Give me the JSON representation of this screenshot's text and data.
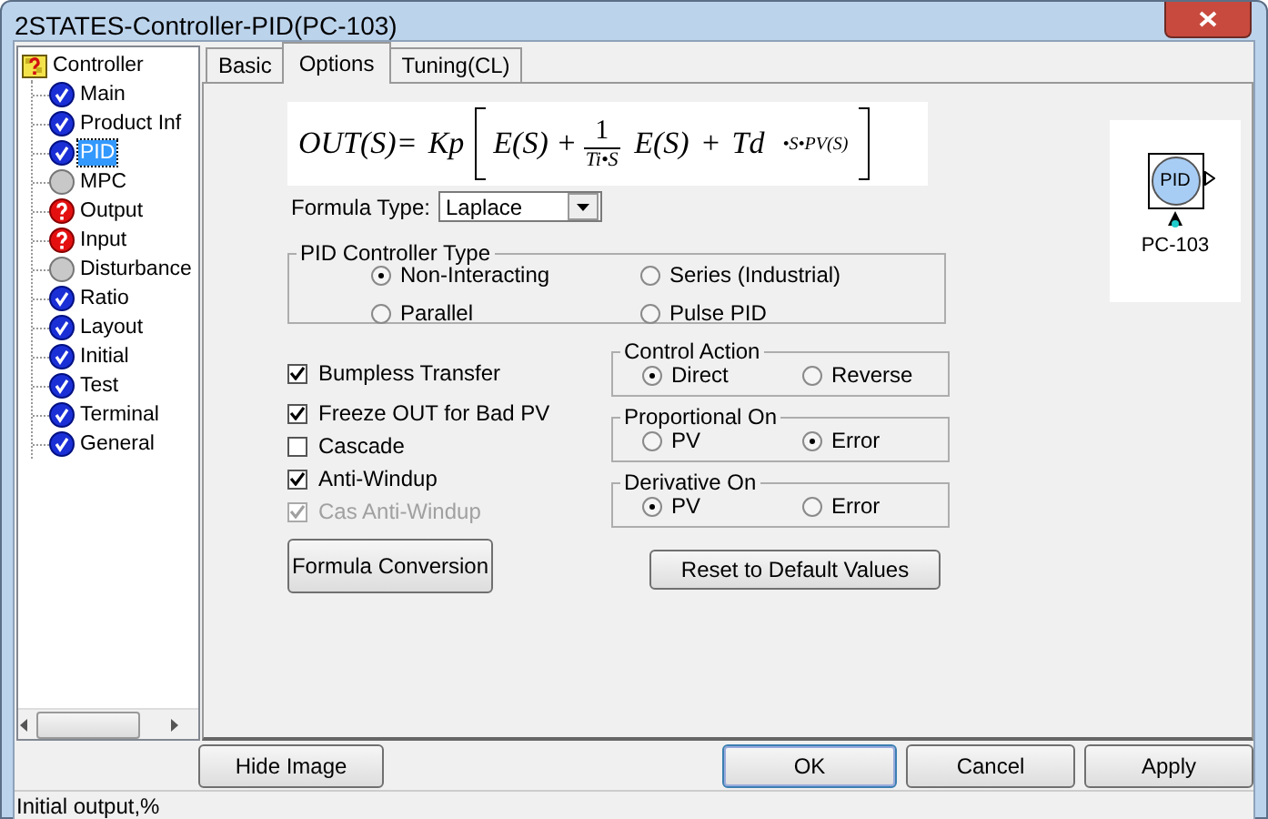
{
  "window": {
    "title": "2STATES-Controller-PID(PC-103)"
  },
  "tree": {
    "label": "Controller",
    "children": [
      {
        "label": "Main",
        "kind": "ok",
        "selected": false
      },
      {
        "label": "Product Inf",
        "kind": "ok",
        "selected": false
      },
      {
        "label": "PID",
        "kind": "ok",
        "selected": true
      },
      {
        "label": "MPC",
        "kind": "none",
        "selected": false
      },
      {
        "label": "Output",
        "kind": "error",
        "selected": false
      },
      {
        "label": "Input",
        "kind": "error",
        "selected": false
      },
      {
        "label": "Disturbance",
        "kind": "none",
        "selected": false
      },
      {
        "label": "Ratio",
        "kind": "ok",
        "selected": false
      },
      {
        "label": "Layout",
        "kind": "ok",
        "selected": false
      },
      {
        "label": "Initial",
        "kind": "ok",
        "selected": false
      },
      {
        "label": "Test",
        "kind": "ok",
        "selected": false
      },
      {
        "label": "Terminal",
        "kind": "ok",
        "selected": false
      },
      {
        "label": "General",
        "kind": "ok",
        "selected": false
      }
    ]
  },
  "tabs": [
    {
      "label": "Basic",
      "selected": false
    },
    {
      "label": "Options",
      "selected": true
    },
    {
      "label": "Tuning(CL)",
      "selected": false
    }
  ],
  "formula": [
    {
      "kind": "text",
      "text": "OUT(S)="
    },
    {
      "kind": "text",
      "text": "Kp"
    },
    {
      "kind": "open"
    },
    {
      "kind": "text",
      "text": "E(S) +"
    },
    {
      "kind": "frac",
      "num": "1",
      "den": "Ti•S"
    },
    {
      "kind": "text",
      "text": "E(S)"
    },
    {
      "kind": "text",
      "text": "+"
    },
    {
      "kind": "text",
      "text": "Td"
    },
    {
      "kind": "small",
      "text": "•S•PV(S)"
    },
    {
      "kind": "close"
    }
  ],
  "formula_type": {
    "label": "Formula Type:",
    "value": "Laplace"
  },
  "pid_type": {
    "title": "PID Controller Type",
    "options": [
      {
        "label": "Non-Interacting",
        "selected": true
      },
      {
        "label": "Series (Industrial)",
        "selected": false
      },
      {
        "label": "Parallel",
        "selected": false
      },
      {
        "label": "Pulse PID",
        "selected": false
      }
    ]
  },
  "checkboxes": [
    {
      "label": "Bumpless Transfer",
      "checked": true,
      "disabled": false
    },
    {
      "label": "Freeze OUT for Bad PV",
      "checked": true,
      "disabled": false
    },
    {
      "label": "Cascade",
      "checked": false,
      "disabled": false
    },
    {
      "label": "Anti-Windup",
      "checked": true,
      "disabled": false
    },
    {
      "label": "Cas Anti-Windup",
      "checked": true,
      "disabled": true
    }
  ],
  "groups": [
    {
      "title": "Control Action",
      "options": [
        {
          "label": "Direct",
          "selected": true
        },
        {
          "label": "Reverse",
          "selected": false
        }
      ]
    },
    {
      "title": "Proportional On",
      "options": [
        {
          "label": "PV",
          "selected": false
        },
        {
          "label": "Error",
          "selected": true
        }
      ]
    },
    {
      "title": "Derivative On",
      "options": [
        {
          "label": "PV",
          "selected": true
        },
        {
          "label": "Error",
          "selected": false
        }
      ]
    }
  ],
  "formula_button": "Formula Conversion",
  "reset_button": "Reset to Default Values",
  "image": {
    "label": "PID",
    "caption": "PC-103"
  },
  "buttons": [
    {
      "label": "Hide Image",
      "kind": "left"
    },
    {
      "label": "OK",
      "kind": "default"
    },
    {
      "label": "Cancel",
      "kind": "right"
    },
    {
      "label": "Apply",
      "kind": "right"
    }
  ],
  "status_bar": "Initial output,%"
}
